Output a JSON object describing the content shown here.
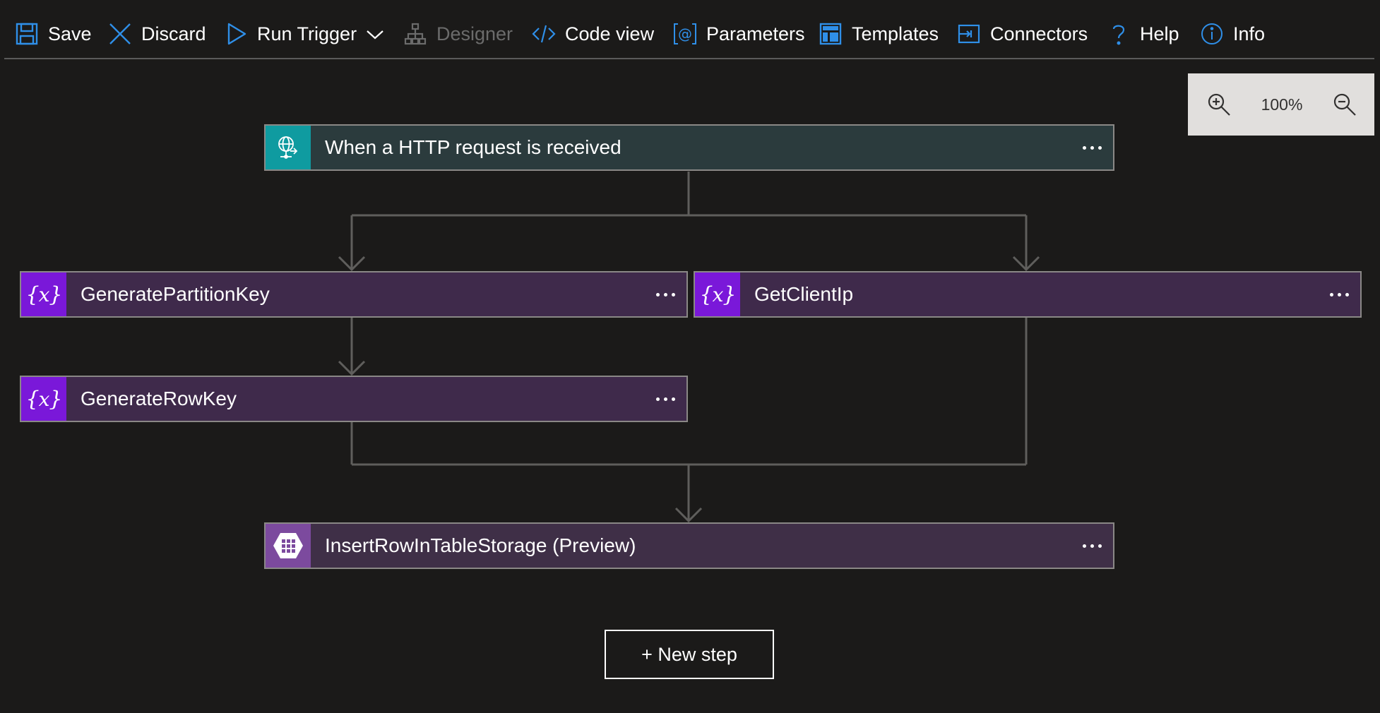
{
  "toolbar": {
    "save": "Save",
    "discard": "Discard",
    "run_trigger": "Run Trigger",
    "designer": "Designer",
    "code_view": "Code view",
    "parameters": "Parameters",
    "templates": "Templates",
    "connectors": "Connectors",
    "help": "Help",
    "info": "Info"
  },
  "zoom": {
    "level": "100%"
  },
  "workflow": {
    "trigger": {
      "title": "When a HTTP request is received",
      "icon": "http-request-icon"
    },
    "actions": [
      {
        "title": "GeneratePartitionKey",
        "icon": "variable-icon"
      },
      {
        "title": "GetClientIp",
        "icon": "variable-icon"
      },
      {
        "title": "GenerateRowKey",
        "icon": "variable-icon"
      },
      {
        "title": "InsertRowInTableStorage (Preview)",
        "icon": "table-storage-icon"
      }
    ],
    "new_step": "+ New step"
  },
  "colors": {
    "background": "#1b1a19",
    "accent_blue": "#2f8fe8",
    "trigger_icon_bg": "#0f9ba0",
    "trigger_card_bg": "#2b3b3d",
    "variable_icon_bg": "#7a18d9",
    "variable_card_bg": "#3f2a4b",
    "storage_icon_bg": "#7c4a9e",
    "connector_line": "#5f5e5c"
  }
}
